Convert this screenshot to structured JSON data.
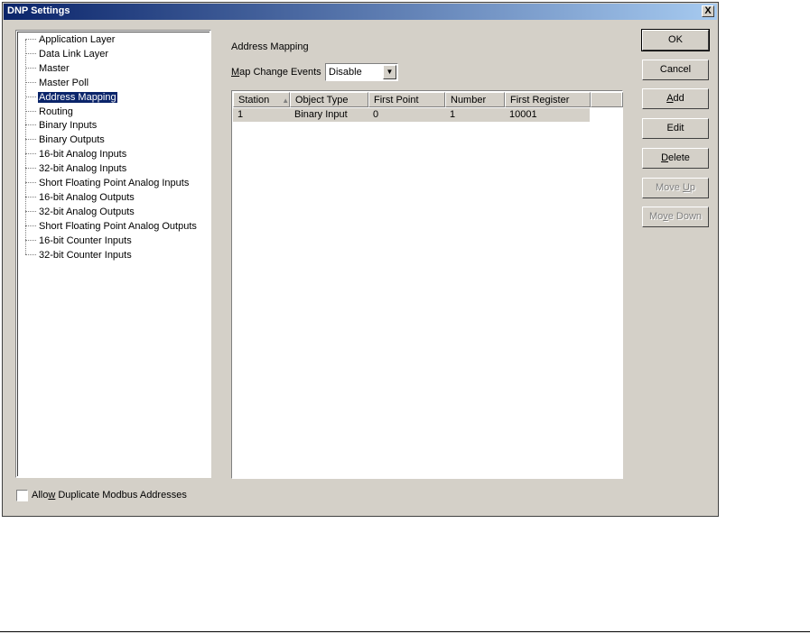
{
  "window": {
    "title": "DNP Settings",
    "close_glyph": "X"
  },
  "tree": {
    "selected": "Address Mapping",
    "items": [
      "Application Layer",
      "Data Link Layer",
      "Master",
      "Master Poll",
      "Address Mapping",
      "Routing",
      "Binary Inputs",
      "Binary Outputs",
      "16-bit Analog Inputs",
      "32-bit Analog Inputs",
      "Short Floating Point Analog Inputs",
      "16-bit Analog Outputs",
      "32-bit Analog Outputs",
      "Short Floating Point Analog Outputs",
      "16-bit Counter Inputs",
      "32-bit Counter Inputs"
    ]
  },
  "panel": {
    "title": "Address Mapping",
    "map_change_events": {
      "label_hotkey": "M",
      "label_rest": "ap Change Events",
      "value": "Disable"
    }
  },
  "table": {
    "columns": [
      "Station",
      "Object Type",
      "First Point",
      "Number",
      "First Register"
    ],
    "rows": [
      [
        "1",
        "Binary Input",
        "0",
        "1",
        "10001"
      ]
    ]
  },
  "buttons": {
    "ok": {
      "label": "OK",
      "enabled": true
    },
    "cancel": {
      "label": "Cancel",
      "enabled": true
    },
    "add": {
      "hotkey": "A",
      "rest": "dd",
      "enabled": true
    },
    "edit": {
      "label": "Edit",
      "enabled": true
    },
    "delete": {
      "hotkey": "D",
      "rest": "elete",
      "enabled": true
    },
    "move_up": {
      "pre": "Move ",
      "hotkey": "U",
      "post": "p",
      "enabled": false
    },
    "move_down": {
      "pre": "Mo",
      "hotkey": "v",
      "post": "e Down",
      "enabled": false
    }
  },
  "checkbox": {
    "pre": "Allo",
    "hotkey": "w",
    "post": " Duplicate Modbus Addresses",
    "checked": false
  },
  "colors": {
    "titlebar_start": "#0a246a",
    "titlebar_end": "#a6caf0",
    "face": "#d4d0c8",
    "selection": "#0a246a"
  }
}
